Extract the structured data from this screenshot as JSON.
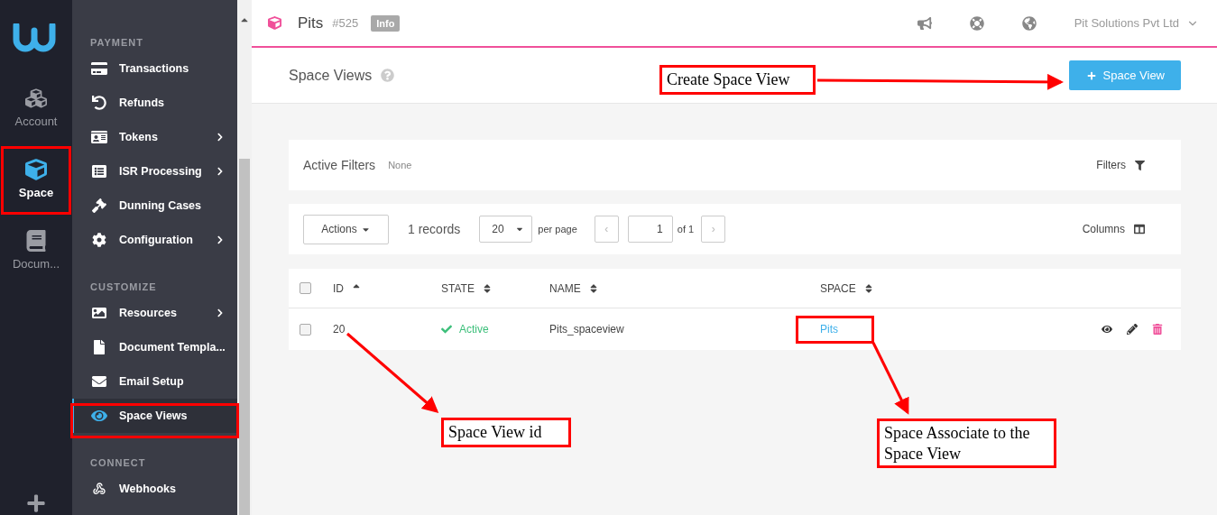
{
  "rail": {
    "items": [
      {
        "label": "Account",
        "selected": false
      },
      {
        "label": "Space",
        "selected": true
      },
      {
        "label": "Docum...",
        "selected": false
      }
    ]
  },
  "nav": {
    "sections": [
      {
        "title": "PAYMENT",
        "items": [
          {
            "label": "Transactions",
            "selected": false,
            "submenu": false
          },
          {
            "label": "Refunds",
            "selected": false,
            "submenu": false
          },
          {
            "label": "Tokens",
            "selected": false,
            "submenu": true
          },
          {
            "label": "ISR Processing",
            "selected": false,
            "submenu": true
          },
          {
            "label": "Dunning Cases",
            "selected": false,
            "submenu": false
          },
          {
            "label": "Configuration",
            "selected": false,
            "submenu": true
          }
        ]
      },
      {
        "title": "CUSTOMIZE",
        "items": [
          {
            "label": "Resources",
            "selected": false,
            "submenu": true
          },
          {
            "label": "Document Templa...",
            "selected": false,
            "submenu": false
          },
          {
            "label": "Email Setup",
            "selected": false,
            "submenu": false
          },
          {
            "label": "Space Views",
            "selected": true,
            "submenu": false
          }
        ]
      },
      {
        "title": "CONNECT",
        "items": [
          {
            "label": "Webhooks",
            "selected": false,
            "submenu": false
          }
        ]
      }
    ]
  },
  "header": {
    "title": "Pits",
    "id": "#525",
    "badge": "Info",
    "account": "Pit Solutions Pvt Ltd"
  },
  "page": {
    "title": "Space Views",
    "add_button": "Space View"
  },
  "filters": {
    "label": "Active Filters",
    "value": "None",
    "button": "Filters"
  },
  "toolbar": {
    "actions": "Actions",
    "records": "1 records",
    "per_page_value": "20",
    "per_page_label": "per page",
    "prev": "‹",
    "page": "1",
    "of": "of 1",
    "next": "›",
    "columns": "Columns"
  },
  "table": {
    "select_all": {
      "checked": false
    },
    "columns": [
      {
        "label": "ID",
        "sorted": true
      },
      {
        "label": "STATE",
        "sorted": false
      },
      {
        "label": "NAME",
        "sorted": false
      },
      {
        "label": "SPACE",
        "sorted": false
      }
    ],
    "rows": [
      {
        "checked": false,
        "id": "20",
        "state": "Active",
        "name": "Pits_spaceview",
        "space": "Pits"
      }
    ]
  },
  "annotations": [
    {
      "text": "Create Space View"
    },
    {
      "text": "Space View id"
    },
    {
      "text": "Space Associate to the Space View"
    }
  ]
}
